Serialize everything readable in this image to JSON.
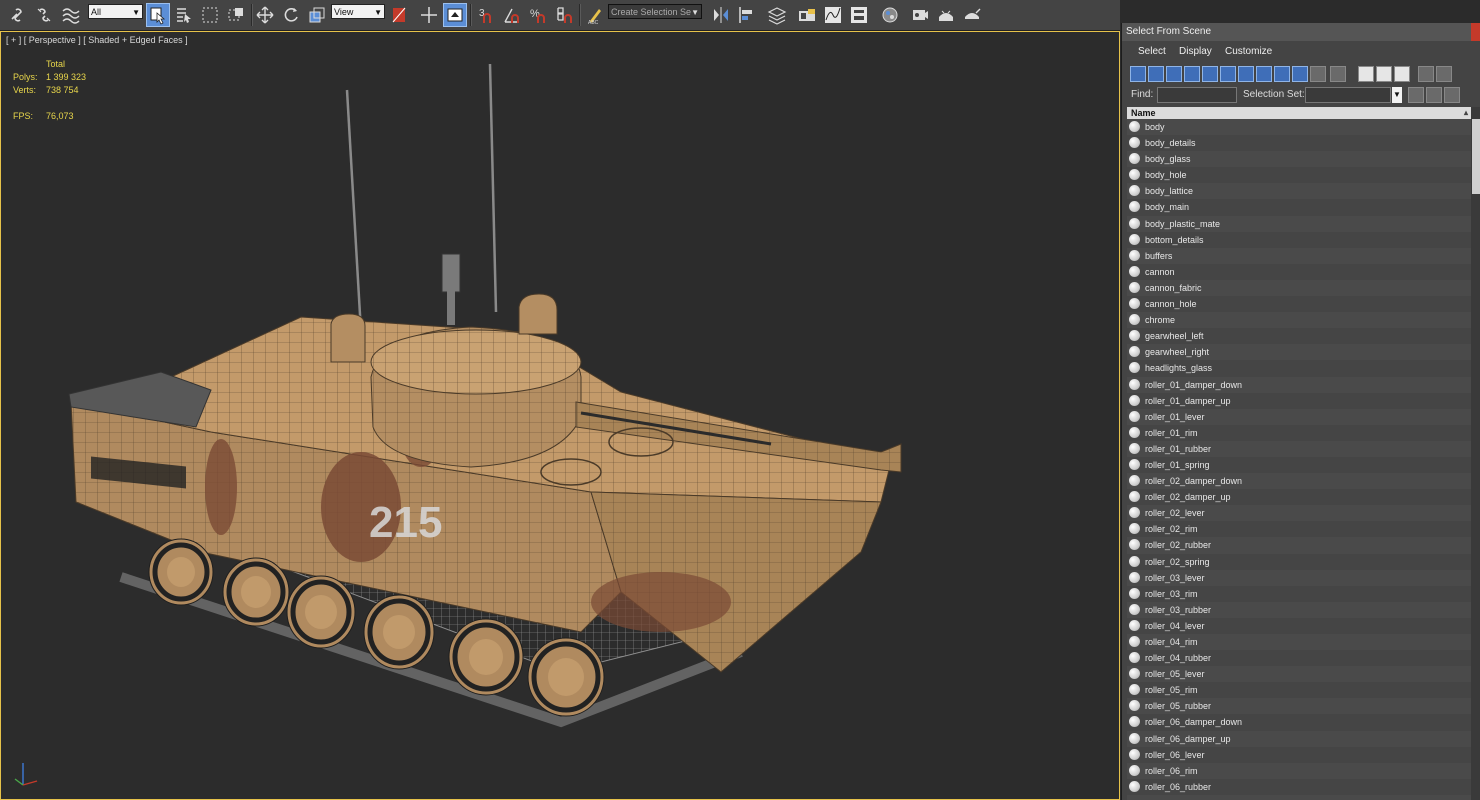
{
  "toolbar": {
    "filter_dropdown": "All",
    "coord_dropdown": "View",
    "selection_set_placeholder": "Create Selection Se",
    "accent": "#5b8ed6",
    "icons": [
      "link-icon",
      "unlink-icon",
      "bind-spacewarp-icon",
      "select-object-icon",
      "select-by-name-icon",
      "rect-region-icon",
      "window-crossing-icon",
      "move-icon",
      "rotate-icon",
      "scale-icon",
      "pivot-icon",
      "select-manipulate-icon",
      "keyboard-shortcut-icon",
      "snap-3d-icon",
      "angle-snap-icon",
      "percent-snap-icon",
      "spinner-snap-icon",
      "edit-named-sets-icon",
      "mirror-icon",
      "align-icon",
      "layer-manager-icon",
      "graphite-ribbon-icon",
      "curve-editor-icon",
      "schematic-view-icon",
      "material-editor-icon",
      "render-setup-icon",
      "rendered-frame-icon",
      "render-icon"
    ]
  },
  "viewport": {
    "label": "[ + ] [ Perspective ] [ Shaded + Edged Faces ]",
    "stats": {
      "header": "Total",
      "polys_label": "Polys:",
      "polys_value": "1 399 323",
      "verts_label": "Verts:",
      "verts_value": "738 754",
      "fps_label": "FPS:",
      "fps_value": "76,073"
    },
    "hull_number": "215",
    "border_color": "#e6c24a"
  },
  "select_panel": {
    "title": "Select From Scene",
    "menus": [
      "Select",
      "Display",
      "Customize"
    ],
    "find_label": "Find:",
    "selection_set_label": "Selection Set:",
    "column_header": "Name",
    "objects": [
      "body",
      "body_details",
      "body_glass",
      "body_hole",
      "body_lattice",
      "body_main",
      "body_plastic_mate",
      "bottom_details",
      "buffers",
      "cannon",
      "cannon_fabric",
      "cannon_hole",
      "chrome",
      "gearwheel_left",
      "gearwheel_right",
      "headlights_glass",
      "roller_01_damper_down",
      "roller_01_damper_up",
      "roller_01_lever",
      "roller_01_rim",
      "roller_01_rubber",
      "roller_01_spring",
      "roller_02_damper_down",
      "roller_02_damper_up",
      "roller_02_lever",
      "roller_02_rim",
      "roller_02_rubber",
      "roller_02_spring",
      "roller_03_lever",
      "roller_03_rim",
      "roller_03_rubber",
      "roller_04_lever",
      "roller_04_rim",
      "roller_04_rubber",
      "roller_05_lever",
      "roller_05_rim",
      "roller_05_rubber",
      "roller_06_damper_down",
      "roller_06_damper_up",
      "roller_06_lever",
      "roller_06_rim",
      "roller_06_rubber"
    ]
  }
}
